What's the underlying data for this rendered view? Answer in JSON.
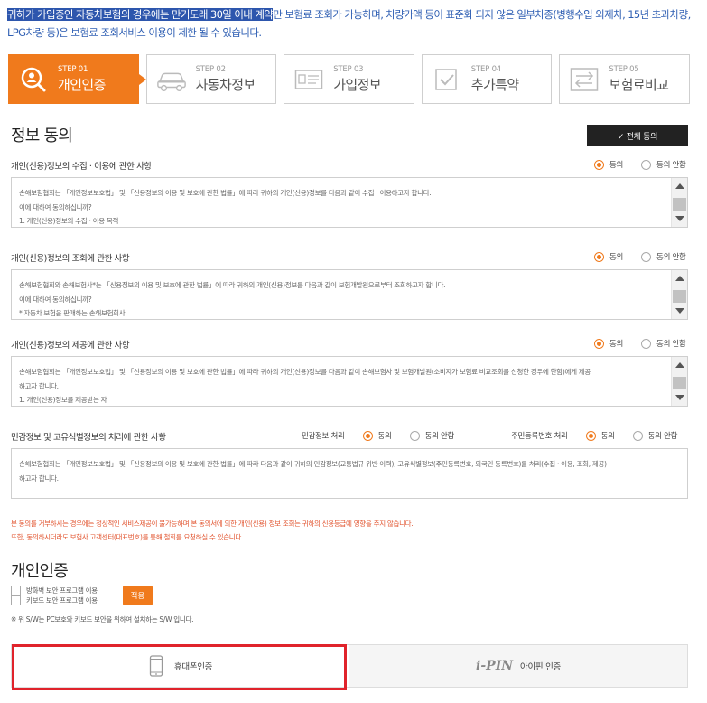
{
  "notice": {
    "highlight": "귀하가 가입중인 자동차보험의 경우에는 만기도래 30일 이내 계약",
    "rest": "만 보험료 조회가 가능하며, 차량가액 등이 표준화 되지 않은 일부차종(병행수입 외제차, 15년 초과차량, LPG차량 등)은 보험료 조회서비스 이용이 제한 될 수 있습니다."
  },
  "steps": [
    {
      "num": "STEP 01",
      "label": "개인인증",
      "icon": "search-person-icon",
      "active": true
    },
    {
      "num": "STEP 02",
      "label": "자동차정보",
      "icon": "car-icon",
      "active": false
    },
    {
      "num": "STEP 03",
      "label": "가입정보",
      "icon": "id-card-icon",
      "active": false
    },
    {
      "num": "STEP 04",
      "label": "추가특약",
      "icon": "checkbox-icon",
      "active": false
    },
    {
      "num": "STEP 05",
      "label": "보험료비교",
      "icon": "compare-arrows-icon",
      "active": false
    }
  ],
  "consent": {
    "title": "정보 동의",
    "agree_all": "✓ 전체 동의",
    "agree": "동의",
    "disagree": "동의 안함",
    "sections": [
      {
        "title": "개인(신용)정보의 수집 · 이용에 관한 사항",
        "lines": [
          "손해보험협회는 「개인정보보호법」 및 「신용정보의 이용 및 보호에 관한 법률」에 따라 귀하의 개인(신용)정보를 다음과 같이 수집 · 이용하고자 합니다.",
          "이에 대하여 동의하십니까?",
          "1. 개인(신용)정보의 수집 · 이용 목적"
        ]
      },
      {
        "title": "개인(신용)정보의 조회에 관한 사항",
        "lines": [
          "손해보험협회와 손해보험사*는 「신용정보의 이용 및 보호에 관한 법률」에 따라 귀하의 개인(신용)정보를 다음과 같이 보험개발원으로부터 조회하고자 합니다.",
          "이에 대하여 동의하십니까?",
          "* 자동차 보험을 판매하는 손해보험회사"
        ]
      },
      {
        "title": "개인(신용)정보의 제공에 관한 사항",
        "lines": [
          "손해보험협회는 「개인정보보호법」 및 「신용정보의 이용 및 보호에 관한 법률」에 따라 귀하의 개인(신용)정보를 다음과 같이 손해보험사 및 보험개발원(소비자가 보험료 비교조회를 신청한 경우에 한함)에게 제공",
          "하고자 합니다.",
          "1. 개인(신용)정보를 제공받는 자"
        ]
      }
    ],
    "sensitive": {
      "title": "민감정보 및 고유식별정보의 처리에 관한 사항",
      "label1": "민감정보 처리",
      "label2": "주민등록번호 처리",
      "lines": [
        "손해보험협회는 「개인정보보호법」 및 「신용정보의 이용 및 보호에 관한 법률」에 따라 다음과 같이 귀하의 민감정보(교통법규 위반 이력), 고유식별정보(주민등록번호, 외국인 등록번호)를 처리(수집 · 이용, 조회, 제공)",
        "하고자 합니다."
      ]
    },
    "warning": [
      "본 동의를 거부하시는 경우에는 정상적인 서비스제공이 불가능하며 본 동의서에 의한 개인(신용) 정보 조회는 귀하의 신용등급에 영향을 주지 않습니다.",
      "또한, 동의하시더라도 보험사 고객센터(대표번호)를 통해 철회를 요청하실 수 있습니다."
    ]
  },
  "auth": {
    "title": "개인인증",
    "firewall_label": "방화벽 보안 프로그램 이용",
    "keyboard_label": "키보드 보안 프로그램 이용",
    "apply": "적용",
    "note": "※ 위 S/W는 PC보호와 키보드 보안을 위하여 설치하는 S/W 입니다.",
    "phone_label": "휴대폰인증",
    "ipin_logo": "i-PIN",
    "ipin_label": "아이핀 인증"
  },
  "colors": {
    "accent": "#f07a1c",
    "highlight_frame": "#e0232b",
    "notice": "#2f5fb3",
    "warning": "#e2542f"
  }
}
